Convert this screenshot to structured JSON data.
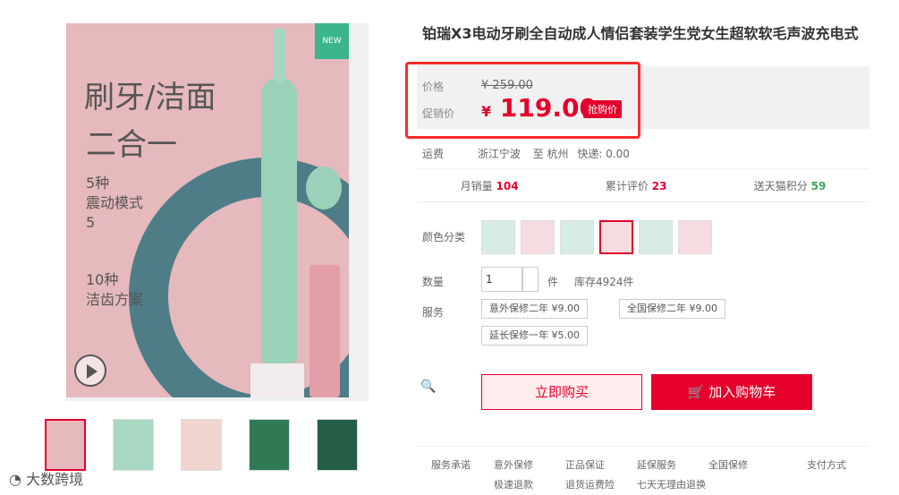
{
  "product": {
    "title": "铂瑞X3电动牙刷全自动成人情侣套装学生党女生超软软毛声波充电式",
    "badge": "NEW",
    "poster": {
      "headline1": "刷牙/洁面",
      "headline2": "二合一",
      "feature1_line1": "5种",
      "feature1_line2": "震动模式",
      "feature1_line3": "5",
      "feature2_line1": "10种",
      "feature2_line2": "洁齿方案"
    }
  },
  "price": {
    "original_label": "价格",
    "original_value": "¥ 259.00",
    "promo_label": "促销价",
    "currency": "¥",
    "promo_value": "119.00",
    "promo_tag": "抢购价"
  },
  "shipping": {
    "label": "运费",
    "from": "浙江宁波",
    "to": "至 杭州",
    "fee": "快递: 0.00"
  },
  "stats": {
    "monthly_sales_label": "月销量",
    "monthly_sales": "104",
    "reviews_label": "累计评价",
    "reviews": "23",
    "points_label": "送天猫积分",
    "points": "59"
  },
  "options": {
    "color_label": "颜色分类",
    "quantity_label": "数量",
    "quantity_value": "1",
    "unit": "件",
    "stock": "库存4924件",
    "service_label": "服务",
    "services": [
      "意外保修二年 ¥9.00",
      "全国保修二年 ¥9.00",
      "延长保修一年 ¥5.00"
    ]
  },
  "actions": {
    "buy_now": "立即购买",
    "add_to_cart": "加入购物车"
  },
  "service_promises": {
    "label": "服务承诺",
    "items": [
      "意外保修",
      "正品保证",
      "延保服务",
      "全国保修",
      "极速退款",
      "退货运费险",
      "七天无理由退换"
    ],
    "payment": "支付方式"
  },
  "watermark": "大数跨境"
}
